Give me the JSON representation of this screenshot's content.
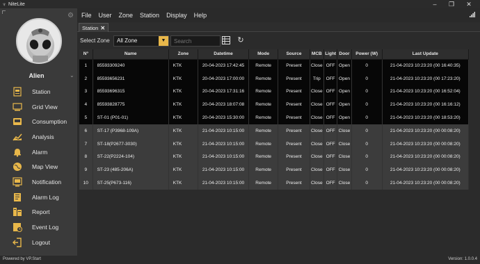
{
  "window": {
    "title": "NiteLite",
    "icon": "lamp-icon",
    "minimize": "–",
    "maximize": "❐",
    "close": "✕"
  },
  "sidebar": {
    "user_name": "Alien",
    "items": [
      {
        "label": "Station",
        "icon": "station-icon"
      },
      {
        "label": "Grid View",
        "icon": "grid-view-icon"
      },
      {
        "label": "Consumption",
        "icon": "consumption-icon"
      },
      {
        "label": "Analysis",
        "icon": "analysis-icon"
      },
      {
        "label": "Alarm",
        "icon": "alarm-icon"
      },
      {
        "label": "Map View",
        "icon": "map-icon"
      },
      {
        "label": "Notification",
        "icon": "notification-icon"
      },
      {
        "label": "Alarm Log",
        "icon": "alarm-log-icon"
      },
      {
        "label": "Report",
        "icon": "report-icon"
      },
      {
        "label": "Event Log",
        "icon": "event-log-icon"
      },
      {
        "label": "Logout",
        "icon": "logout-icon"
      }
    ]
  },
  "menubar": {
    "items": [
      "File",
      "User",
      "Zone",
      "Station",
      "Display",
      "Help"
    ]
  },
  "tab": {
    "label": "Station",
    "close": "✕"
  },
  "toolbar": {
    "select_zone_label": "Select Zone",
    "zone_value": "All Zone",
    "search_placeholder": "Search"
  },
  "table": {
    "columns": [
      "Nº",
      "Name",
      "Zone",
      "Datetime",
      "Mode",
      "Source",
      "MCB",
      "Light",
      "Door",
      "Power (W)",
      "Last Update"
    ],
    "rows": [
      [
        "1",
        "85593309240",
        "KTK",
        "20-04-2023 17:42:45",
        "Remote",
        "Present",
        "Close",
        "OFF",
        "Open",
        "0",
        "21-04-2023 10:23:20 (00 16:40:35)"
      ],
      [
        "2",
        "85593656231",
        "KTK",
        "20-04-2023 17:00:00",
        "Remote",
        "Present",
        "Trip",
        "OFF",
        "Open",
        "0",
        "21-04-2023 10:23:20 (00 17:23:20)"
      ],
      [
        "3",
        "85593696315",
        "KTK",
        "20-04-2023 17:31:16",
        "Remote",
        "Present",
        "Close",
        "OFF",
        "Open",
        "0",
        "21-04-2023 10:23:20 (00 16:52:04)"
      ],
      [
        "4",
        "85593828775",
        "KTK",
        "20-04-2023 18:07:08",
        "Remote",
        "Present",
        "Close",
        "OFF",
        "Open",
        "0",
        "21-04-2023 10:23:20 (00 16:16:12)"
      ],
      [
        "5",
        "ST-01 (P01-01)",
        "KTK",
        "20-04-2023 15:30:00",
        "Remote",
        "Present",
        "Close",
        "OFF",
        "Open",
        "0",
        "21-04-2023 10:23:20 (00 18:53:20)"
      ],
      [
        "6",
        "ST-17 (P3968-109A)",
        "KTK",
        "21-04-2023 10:15:00",
        "Remote",
        "Present",
        "Close",
        "OFF",
        "Close",
        "0",
        "21-04-2023 10:23:20 (00 00:08:20)"
      ],
      [
        "7",
        "ST-18(P2677-3030)",
        "KTK",
        "21-04-2023 10:15:00",
        "Remote",
        "Present",
        "Close",
        "OFF",
        "Close",
        "0",
        "21-04-2023 10:23:20 (00 00:08:20)"
      ],
      [
        "8",
        "ST-22(P2224-104)",
        "KTK",
        "21-04-2023 10:15:00",
        "Remote",
        "Present",
        "Close",
        "OFF",
        "Close",
        "0",
        "21-04-2023 10:23:20 (00 00:08:20)"
      ],
      [
        "9",
        "ST-23 (485-206A)",
        "KTK",
        "21-04-2023 10:15:00",
        "Remote",
        "Present",
        "Close",
        "OFF",
        "Close",
        "0",
        "21-04-2023 10:23:20 (00 00:08:20)"
      ],
      [
        "10",
        "ST-25(P673-116)",
        "KTK",
        "21-04-2023 10:15:00",
        "Remote",
        "Present",
        "Close",
        "OFF",
        "Close",
        "0",
        "21-04-2023 10:23:20 (00 00:08:20)"
      ]
    ]
  },
  "status": {
    "left": "Powered by VP.Start",
    "right": "Version: 1.0.0.4"
  },
  "colors": {
    "accent": "#e8b74a",
    "offline_row": "#070707",
    "online_row": "#3c3c3c"
  }
}
